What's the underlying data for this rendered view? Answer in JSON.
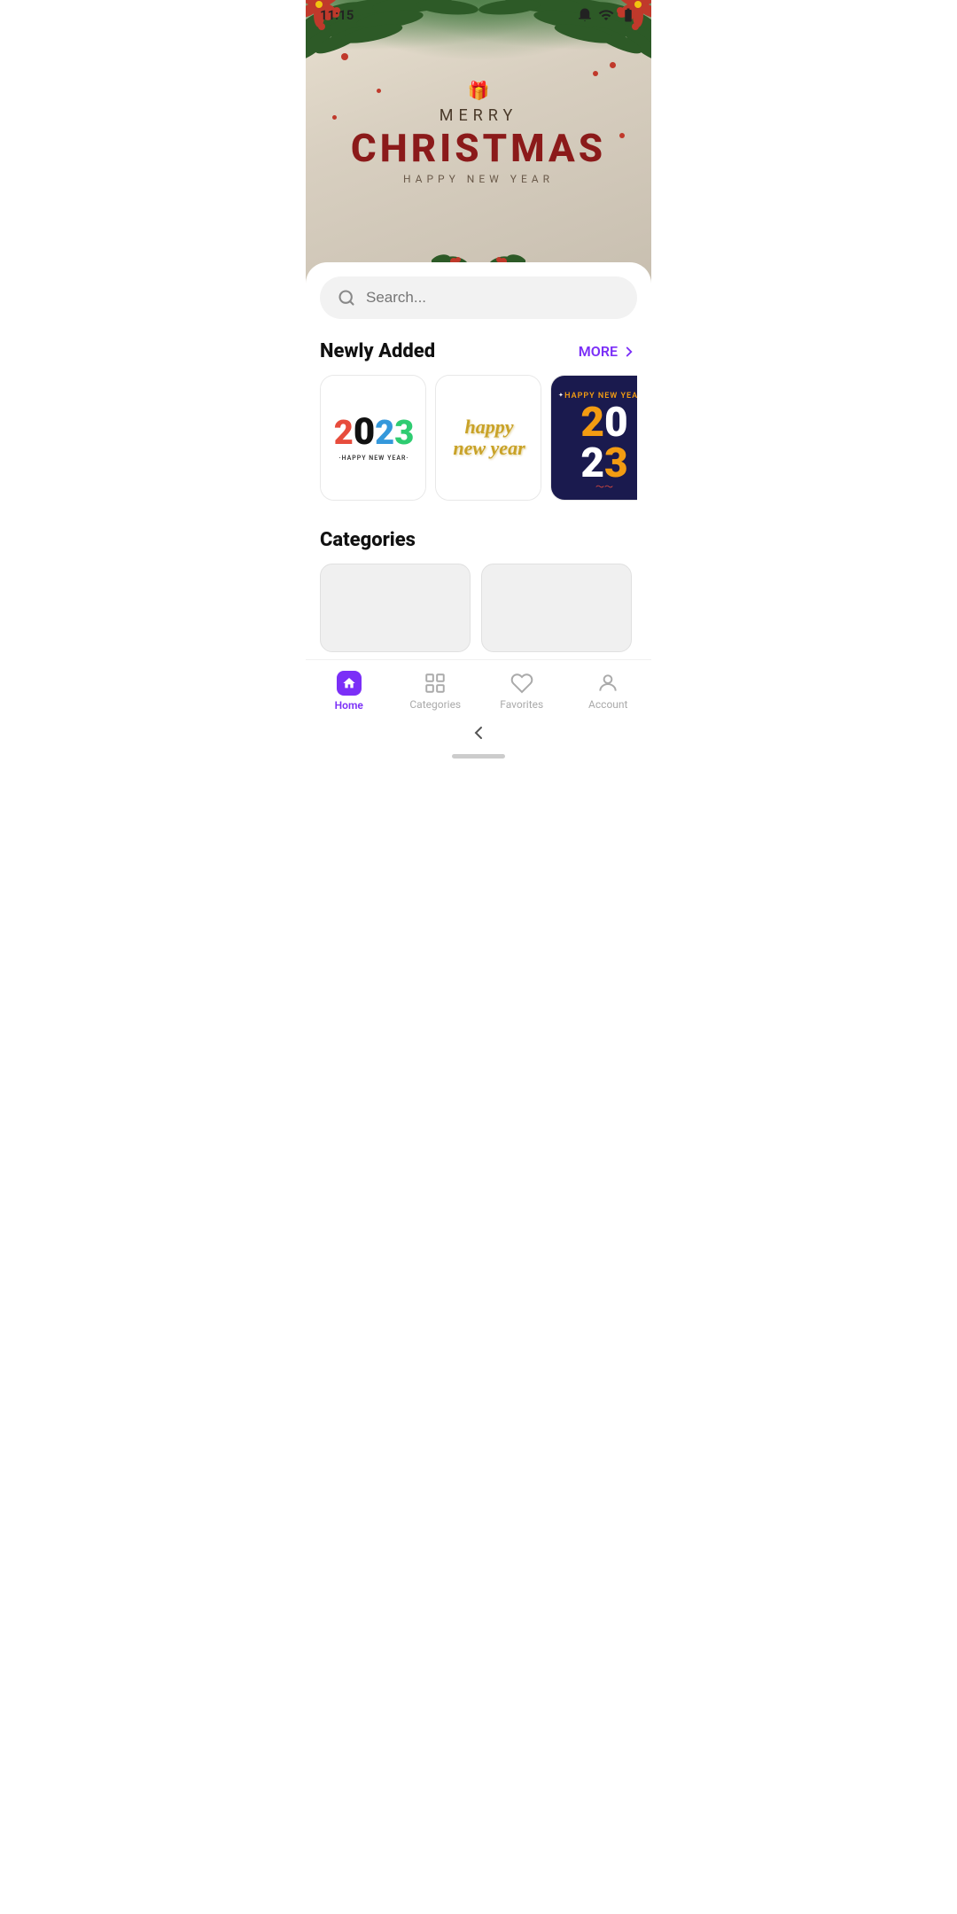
{
  "status_bar": {
    "time": "11:15",
    "wifi_icon": "wifi-icon",
    "battery_icon": "battery-icon"
  },
  "hero": {
    "merry": "MERRY",
    "christmas": "CHRISTMAS",
    "happy_new_year": "HAPPY NEW YEAR"
  },
  "search": {
    "placeholder": "Search..."
  },
  "newly_added": {
    "title": "Newly Added",
    "more_label": "MORE",
    "cards": [
      {
        "id": 1,
        "type": "happy_new_year_colored",
        "year": "2023",
        "subtext": "HAPPY NEW YEAR"
      },
      {
        "id": 2,
        "type": "happy_new_year_gold",
        "text": "happy new year"
      },
      {
        "id": 3,
        "type": "happy_new_year_dark",
        "header": "HAPPY NEW YEAR",
        "year_part1": "20",
        "year_part2": "23"
      },
      {
        "id": 4,
        "type": "partial",
        "text": ""
      }
    ]
  },
  "categories": {
    "title": "Categories",
    "items": [
      {
        "id": 1,
        "label": ""
      },
      {
        "id": 2,
        "label": ""
      }
    ]
  },
  "bottom_nav": {
    "items": [
      {
        "id": "home",
        "label": "Home",
        "active": true
      },
      {
        "id": "categories",
        "label": "Categories",
        "active": false
      },
      {
        "id": "favorites",
        "label": "Favorites",
        "active": false
      },
      {
        "id": "account",
        "label": "Account",
        "active": false
      }
    ]
  },
  "back_button": "‹",
  "handle": ""
}
